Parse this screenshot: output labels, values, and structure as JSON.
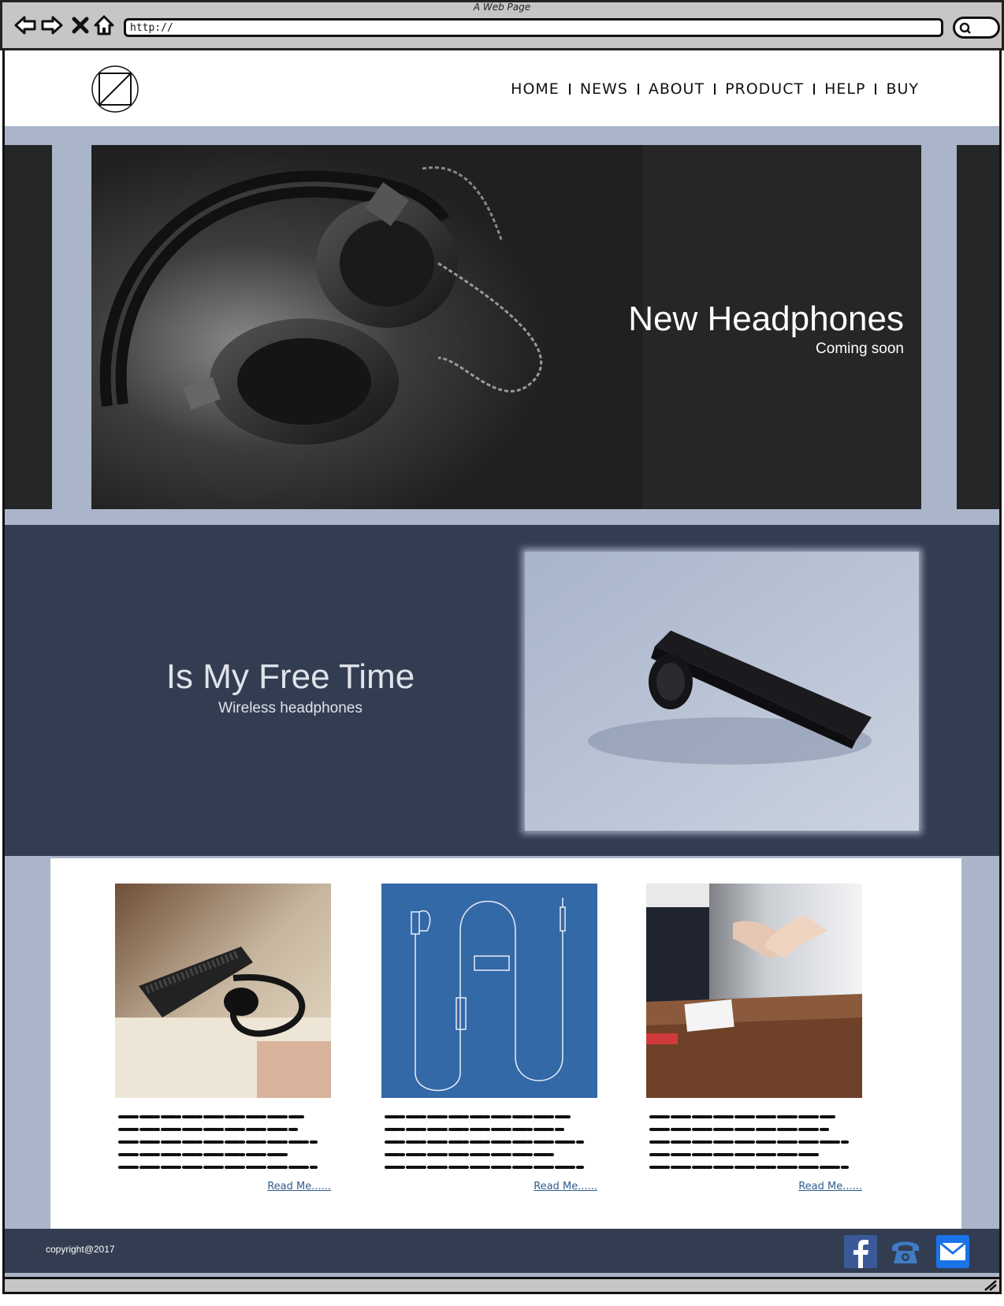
{
  "browser": {
    "window_title": "A Web Page",
    "url": "http://"
  },
  "nav": {
    "items": [
      {
        "label": "HOME"
      },
      {
        "label": "NEWS"
      },
      {
        "label": "ABOUT"
      },
      {
        "label": "PRODUCT"
      },
      {
        "label": "HELP"
      },
      {
        "label": "BUY"
      }
    ]
  },
  "hero": {
    "title": "New Headphones",
    "subtitle": "Coming soon"
  },
  "feature": {
    "title": "Is My Free Time",
    "subtitle": "Wireless headphones"
  },
  "cards": [
    {
      "read_more": "Read Me......",
      "image": "bluetooth-earpiece-photo"
    },
    {
      "read_more": "Read Me......",
      "image": "earphones-blueprint-illustration"
    },
    {
      "read_more": "Read Me......",
      "image": "handshake-photo"
    }
  ],
  "footer": {
    "copyright": "copyright@2017",
    "social_icons": [
      "facebook-icon",
      "phone-icon",
      "mail-icon"
    ]
  },
  "colors": {
    "page_background": "#aab5c9",
    "dark_band": "#333d52",
    "hero_background": "#262628",
    "link": "#2f5d8c",
    "facebook": "#3b5998",
    "mail": "#1a73e8"
  }
}
